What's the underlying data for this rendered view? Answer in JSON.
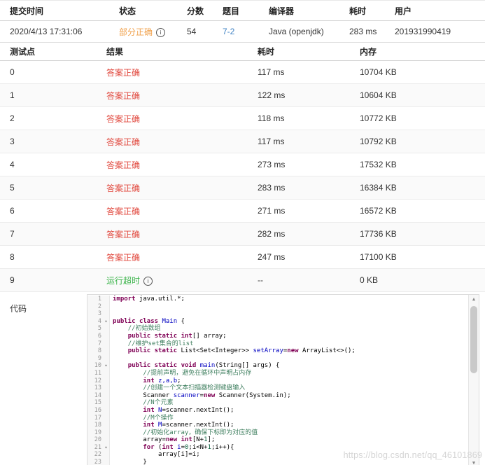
{
  "icons": {
    "info": "i",
    "fold": "▾",
    "scroll_up": "▲",
    "scroll_down": "▼"
  },
  "colors": {
    "partial": "#f0a04a",
    "correct": "#e1493f",
    "timeout": "#3cb44b",
    "link": "#4183c4"
  },
  "submission_table": {
    "headers": [
      "提交时间",
      "状态",
      "分数",
      "题目",
      "编译器",
      "耗时",
      "用户"
    ],
    "row": {
      "time": "2020/4/13 17:31:06",
      "status": "部分正确",
      "score": "54",
      "problem": "7-2",
      "compiler": "Java (openjdk)",
      "duration": "283 ms",
      "user": "201931990419"
    }
  },
  "testcase_table": {
    "headers": [
      "测试点",
      "结果",
      "耗时",
      "内存"
    ],
    "rows": [
      {
        "id": "0",
        "result": "答案正确",
        "type": "correct",
        "time": "117 ms",
        "memory": "10704 KB",
        "info": false
      },
      {
        "id": "1",
        "result": "答案正确",
        "type": "correct",
        "time": "122 ms",
        "memory": "10604 KB",
        "info": false
      },
      {
        "id": "2",
        "result": "答案正确",
        "type": "correct",
        "time": "118 ms",
        "memory": "10772 KB",
        "info": false
      },
      {
        "id": "3",
        "result": "答案正确",
        "type": "correct",
        "time": "117 ms",
        "memory": "10792 KB",
        "info": false
      },
      {
        "id": "4",
        "result": "答案正确",
        "type": "correct",
        "time": "273 ms",
        "memory": "17532 KB",
        "info": false
      },
      {
        "id": "5",
        "result": "答案正确",
        "type": "correct",
        "time": "283 ms",
        "memory": "16384 KB",
        "info": false
      },
      {
        "id": "6",
        "result": "答案正确",
        "type": "correct",
        "time": "271 ms",
        "memory": "16572 KB",
        "info": false
      },
      {
        "id": "7",
        "result": "答案正确",
        "type": "correct",
        "time": "282 ms",
        "memory": "17736 KB",
        "info": false
      },
      {
        "id": "8",
        "result": "答案正确",
        "type": "correct",
        "time": "247 ms",
        "memory": "17100 KB",
        "info": false
      },
      {
        "id": "9",
        "result": "运行超时",
        "type": "timeout",
        "time": "--",
        "memory": "0 KB",
        "info": true
      }
    ]
  },
  "code_section": {
    "label": "代码",
    "lines": [
      {
        "n": 1,
        "fold": false,
        "t": [
          [
            "k",
            "import"
          ],
          [
            "p",
            " java.util.*;"
          ]
        ]
      },
      {
        "n": 2,
        "fold": false,
        "t": []
      },
      {
        "n": 3,
        "fold": false,
        "t": []
      },
      {
        "n": 4,
        "fold": true,
        "t": [
          [
            "k",
            "public"
          ],
          [
            "p",
            " "
          ],
          [
            "k",
            "class"
          ],
          [
            "p",
            " "
          ],
          [
            "d",
            "Main"
          ],
          [
            "p",
            " {"
          ]
        ]
      },
      {
        "n": 5,
        "fold": false,
        "t": [
          [
            "p",
            "    "
          ],
          [
            "c",
            "//初始数组"
          ]
        ]
      },
      {
        "n": 6,
        "fold": false,
        "t": [
          [
            "p",
            "    "
          ],
          [
            "k",
            "public"
          ],
          [
            "p",
            " "
          ],
          [
            "k",
            "static"
          ],
          [
            "p",
            " "
          ],
          [
            "k",
            "int"
          ],
          [
            "p",
            "[] array;"
          ]
        ]
      },
      {
        "n": 7,
        "fold": false,
        "t": [
          [
            "p",
            "    "
          ],
          [
            "c",
            "//维护set集合的list"
          ]
        ]
      },
      {
        "n": 8,
        "fold": false,
        "t": [
          [
            "p",
            "    "
          ],
          [
            "k",
            "public"
          ],
          [
            "p",
            " "
          ],
          [
            "k",
            "static"
          ],
          [
            "p",
            " List<Set<Integer>> "
          ],
          [
            "d",
            "setArray"
          ],
          [
            "p",
            "="
          ],
          [
            "k",
            "new"
          ],
          [
            "p",
            " ArrayList<>();"
          ]
        ]
      },
      {
        "n": 9,
        "fold": false,
        "t": []
      },
      {
        "n": 10,
        "fold": true,
        "t": [
          [
            "p",
            "    "
          ],
          [
            "k",
            "public"
          ],
          [
            "p",
            " "
          ],
          [
            "k",
            "static"
          ],
          [
            "p",
            " "
          ],
          [
            "k",
            "void"
          ],
          [
            "p",
            " "
          ],
          [
            "d",
            "main"
          ],
          [
            "p",
            "(String[] args) {"
          ]
        ]
      },
      {
        "n": 11,
        "fold": false,
        "t": [
          [
            "p",
            "        "
          ],
          [
            "c",
            "//提前声明，避免在循环中声明占内存"
          ]
        ]
      },
      {
        "n": 12,
        "fold": false,
        "t": [
          [
            "p",
            "        "
          ],
          [
            "k",
            "int"
          ],
          [
            "p",
            " "
          ],
          [
            "d",
            "z,a,b"
          ],
          [
            "p",
            ";"
          ]
        ]
      },
      {
        "n": 13,
        "fold": false,
        "t": [
          [
            "p",
            "        "
          ],
          [
            "c",
            "//创建一个文本扫描器检测键盘输入"
          ]
        ]
      },
      {
        "n": 14,
        "fold": false,
        "t": [
          [
            "p",
            "        Scanner "
          ],
          [
            "d",
            "scanner"
          ],
          [
            "p",
            "="
          ],
          [
            "k",
            "new"
          ],
          [
            "p",
            " Scanner(System.in);"
          ]
        ]
      },
      {
        "n": 15,
        "fold": false,
        "t": [
          [
            "p",
            "        "
          ],
          [
            "c",
            "//N个元素"
          ]
        ]
      },
      {
        "n": 16,
        "fold": false,
        "t": [
          [
            "p",
            "        "
          ],
          [
            "k",
            "int"
          ],
          [
            "p",
            " "
          ],
          [
            "d",
            "N"
          ],
          [
            "p",
            "=scanner.nextInt();"
          ]
        ]
      },
      {
        "n": 17,
        "fold": false,
        "t": [
          [
            "p",
            "        "
          ],
          [
            "c",
            "//M个操作"
          ]
        ]
      },
      {
        "n": 18,
        "fold": false,
        "t": [
          [
            "p",
            "        "
          ],
          [
            "k",
            "int"
          ],
          [
            "p",
            " "
          ],
          [
            "d",
            "M"
          ],
          [
            "p",
            "=scanner.nextInt();"
          ]
        ]
      },
      {
        "n": 19,
        "fold": false,
        "t": [
          [
            "p",
            "        "
          ],
          [
            "c",
            "//初始化array，确保下标即为对应的值"
          ]
        ]
      },
      {
        "n": 20,
        "fold": false,
        "t": [
          [
            "p",
            "        array="
          ],
          [
            "k",
            "new"
          ],
          [
            "p",
            " "
          ],
          [
            "k",
            "int"
          ],
          [
            "p",
            "[N+"
          ],
          [
            "n",
            "1"
          ],
          [
            "p",
            "];"
          ]
        ]
      },
      {
        "n": 21,
        "fold": true,
        "t": [
          [
            "p",
            "        "
          ],
          [
            "k",
            "for"
          ],
          [
            "p",
            " ("
          ],
          [
            "k",
            "int"
          ],
          [
            "p",
            " "
          ],
          [
            "d",
            "i"
          ],
          [
            "p",
            "="
          ],
          [
            "n",
            "0"
          ],
          [
            "p",
            ";i<N+"
          ],
          [
            "n",
            "1"
          ],
          [
            "p",
            ";i++){"
          ]
        ]
      },
      {
        "n": 22,
        "fold": false,
        "t": [
          [
            "p",
            "            array[i]=i;"
          ]
        ]
      },
      {
        "n": 23,
        "fold": false,
        "t": [
          [
            "p",
            "        }"
          ]
        ]
      }
    ]
  },
  "watermark": "https://blog.csdn.net/qq_46101869"
}
